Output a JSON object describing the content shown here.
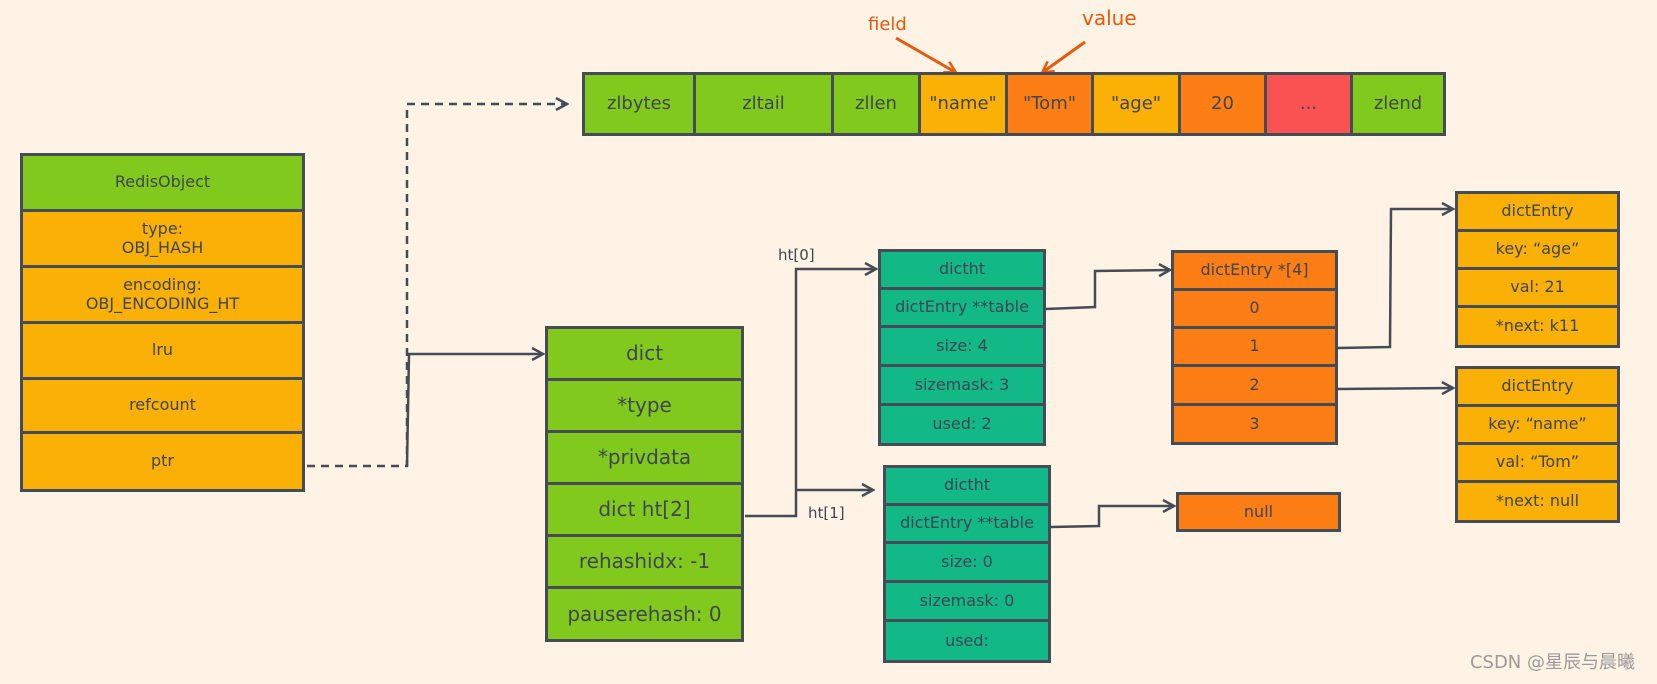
{
  "ziplist": {
    "cells": [
      {
        "label": "zlbytes",
        "color": "#82c91e"
      },
      {
        "label": "zltail",
        "color": "#82c91e"
      },
      {
        "label": "zllen",
        "color": "#82c91e"
      },
      {
        "label": "\"name\"",
        "color": "#fab005"
      },
      {
        "label": "\"Tom\"",
        "color": "#fd7e14"
      },
      {
        "label": "\"age\"",
        "color": "#fab005"
      },
      {
        "label": "20",
        "color": "#fd7e14"
      },
      {
        "label": "...",
        "color": "#fa5252"
      },
      {
        "label": "zlend",
        "color": "#82c91e"
      }
    ],
    "annotations": {
      "field": "field",
      "value": "value"
    }
  },
  "redis_object": {
    "title": "RedisObject",
    "fields": [
      "type:\nOBJ_HASH",
      "encoding:\nOBJ_ENCODING_HT",
      "lru",
      "refcount",
      "ptr"
    ]
  },
  "dict": {
    "title": "dict",
    "fields": [
      "*type",
      "*privdata",
      "dict ht[2]",
      "rehashidx: -1",
      "pauserehash: 0"
    ]
  },
  "labels": {
    "ht0": "ht[0]",
    "ht1": "ht[1]"
  },
  "dictht0": {
    "title": "dictht",
    "fields": [
      "dictEntry **table",
      "size: 4",
      "sizemask: 3",
      "used: 2"
    ]
  },
  "dictht1": {
    "title": "dictht",
    "fields": [
      "dictEntry **table",
      "size: 0",
      "sizemask: 0",
      "used:"
    ]
  },
  "table": {
    "title": "dictEntry *[4]",
    "slots": [
      "0",
      "1",
      "2",
      "3"
    ]
  },
  "null_table": {
    "label": "null"
  },
  "entry_age": {
    "title": "dictEntry",
    "fields": [
      "key: “age”",
      "val: 21",
      "*next: k11"
    ]
  },
  "entry_name": {
    "title": "dictEntry",
    "fields": [
      "key: “name”",
      "val: “Tom”",
      "*next: null"
    ]
  },
  "watermark": "CSDN @星辰与晨曦",
  "colors": {
    "background": "#fff3e6",
    "stroke": "#454c56",
    "green": "#82c91e",
    "amber": "#fab005",
    "orange": "#fd7e14",
    "red": "#fa5252",
    "teal": "#12b886",
    "annotation": "#e8590c"
  }
}
